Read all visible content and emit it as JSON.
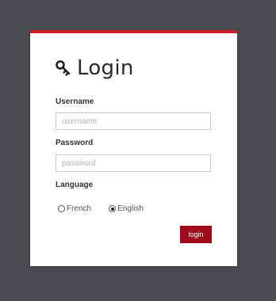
{
  "login": {
    "title": "Login",
    "username_label": "Username",
    "username_placeholder": "username",
    "password_label": "Password",
    "password_placeholder": "password",
    "language_label": "Language",
    "language_options": [
      {
        "label": "French",
        "selected": false
      },
      {
        "label": "English",
        "selected": true
      }
    ],
    "submit_label": "login"
  },
  "colors": {
    "background": "#4a4b50",
    "accent": "#cc1e2b",
    "button": "#9e0b1b"
  }
}
